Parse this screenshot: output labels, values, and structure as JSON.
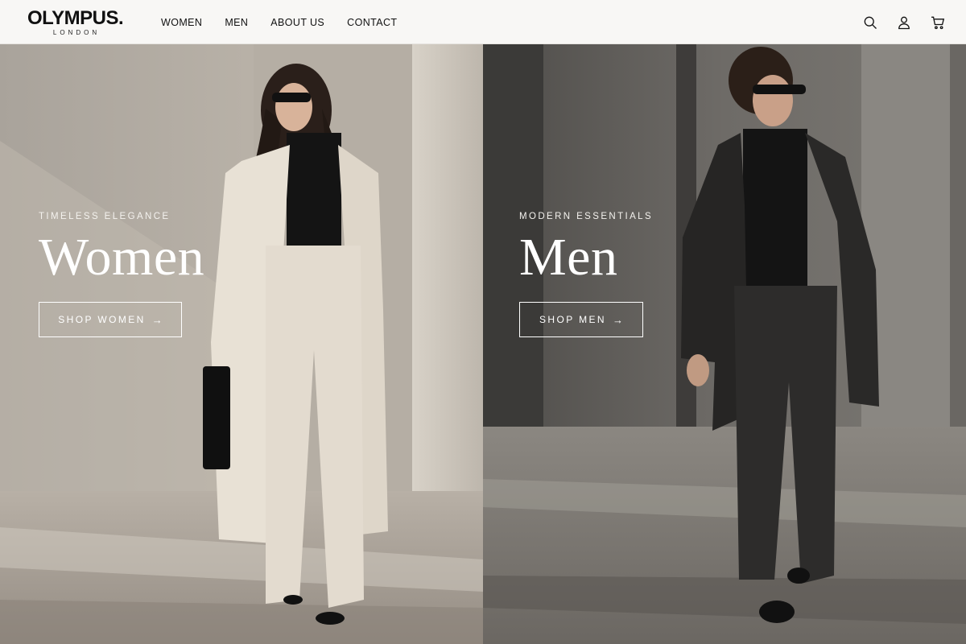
{
  "brand": {
    "name": "OLYMPUS.",
    "tagline": "LONDON"
  },
  "nav": {
    "items": [
      "WOMEN",
      "MEN",
      "ABOUT US",
      "CONTACT"
    ]
  },
  "header_icons": [
    "search-icon",
    "account-icon",
    "cart-icon"
  ],
  "hero": {
    "women": {
      "eyebrow": "TIMELESS ELEGANCE",
      "title": "Women",
      "cta": "SHOP WOMEN",
      "cta_arrow": "→"
    },
    "men": {
      "eyebrow": "MODERN ESSENTIALS",
      "title": "Men",
      "cta": "SHOP MEN",
      "cta_arrow": "→"
    }
  },
  "colors": {
    "text": "#111111",
    "header_bg": "#f8f7f5",
    "hero_text": "#ffffff"
  }
}
